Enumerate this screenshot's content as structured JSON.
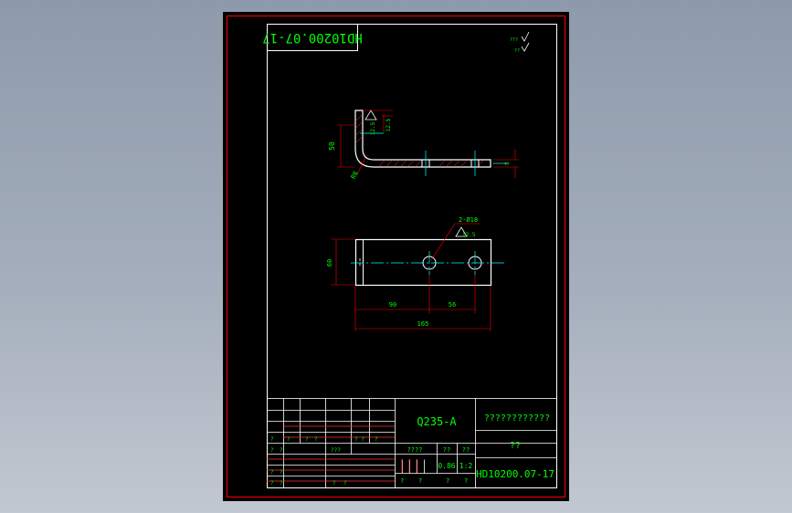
{
  "colors": {
    "background": "#000000",
    "sheet_border": "#ff0000",
    "linework": "#ffffff",
    "centerline": "#00ffff",
    "dimension": "#ff0000",
    "text": "#00ff00",
    "hatch": "#ff3030"
  },
  "drawing": {
    "rotated_code": "HD10200.07-17",
    "roughness_legend": [
      "???",
      "??"
    ],
    "front_view": {
      "dim_height": "50",
      "dim_radius": "R8",
      "dim_thickness": "8",
      "roughness_value": "12.5",
      "roughness_value_2": "12.5"
    },
    "top_view": {
      "hole_callout": "2-Ø18",
      "hole_roughness": "12.5",
      "dim_width": "60",
      "dim_hole1": "90",
      "dim_spacing": "56",
      "dim_total": "165"
    }
  },
  "title_block": {
    "material": "Q235-A",
    "company": "????????????",
    "part_name": "??",
    "drawing_number": "HD10200.07-17",
    "weight": "0.86",
    "scale": "1:2",
    "stage_label": "????",
    "weight_label": "??",
    "scale_label": "??",
    "sheet_cells": [
      "?",
      "?",
      "?",
      "?"
    ],
    "rev_cells_row1": [
      "?",
      "?",
      "?",
      "?",
      "? ?",
      "?"
    ],
    "rev_cells_row2": [
      "?",
      "?",
      "???"
    ],
    "rev_cells_row3": [
      "?",
      "?"
    ],
    "rev_cells_row4": [
      "?",
      "?",
      "?",
      "?"
    ]
  }
}
